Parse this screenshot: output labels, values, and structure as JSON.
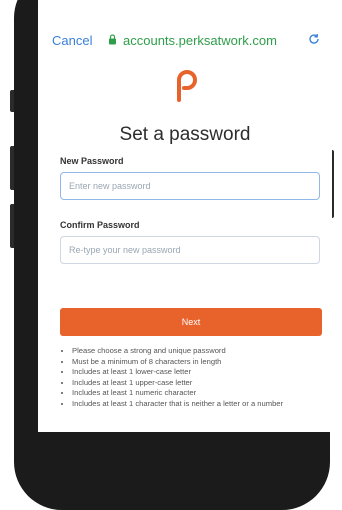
{
  "browser": {
    "cancel_label": "Cancel",
    "domain": "accounts.perksatwork.com",
    "icons": [
      "lock-icon",
      "reload-icon"
    ]
  },
  "brand": {
    "logo_color": "#e8622c",
    "logo_icon": "perks-logo"
  },
  "page": {
    "title": "Set a password",
    "new_password": {
      "label": "New Password",
      "placeholder": "Enter new password"
    },
    "confirm_password": {
      "label": "Confirm Password",
      "placeholder": "Re-type your new password"
    },
    "next_label": "Next",
    "rules": [
      "Please choose a strong and unique password",
      "Must be a minimum of 8 characters in length",
      "Includes at least 1 lower-case letter",
      "Includes at least 1 upper-case letter",
      "Includes at least 1 numeric character",
      "Includes at least 1 character that is neither a letter or a number"
    ]
  },
  "colors": {
    "accent": "#e8622c",
    "link": "#3a7fd8",
    "secure": "#2f9e4a"
  }
}
